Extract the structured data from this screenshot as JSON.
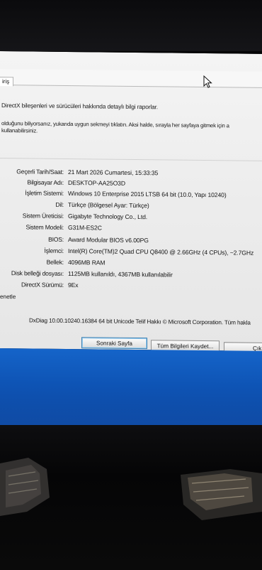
{
  "window": {
    "tab_label": "iriş",
    "intro_text": "DirectX bileşenleri ve sürücüleri hakkında detaylı bilgi raporlar.",
    "hint_line1": "olduğunu biliyorsanız, yukarıda uygun sekmeyi tıklatın. Aksi halde, sırayla her sayfaya gitmek için a",
    "hint_line2": "kullanabilirsiniz."
  },
  "system_info": [
    {
      "label": "Geçerli Tarih/Saat:",
      "value": "21 Mart 2026 Cumartesi, 15:33:35"
    },
    {
      "label": "Bilgisayar Adı:",
      "value": "DESKTOP-AA25O3D"
    },
    {
      "label": "İşletim Sistemi:",
      "value": "Windows 10 Enterprise 2015 LTSB 64 bit (10.0, Yapı 10240)"
    },
    {
      "label": "Dil:",
      "value": "Türkçe (Bölgesel Ayar: Türkçe)"
    },
    {
      "label": "Sistem Üreticisi:",
      "value": "Gigabyte Technology Co., Ltd."
    },
    {
      "label": "Sistem Modeli:",
      "value": "G31M-ES2C"
    },
    {
      "label": "BIOS:",
      "value": "Award Modular BIOS v6.00PG"
    },
    {
      "label": "İşlemci:",
      "value": "Intel(R) Core(TM)2 Quad CPU    Q8400  @ 2.66GHz (4 CPUs), ~2.7GHz"
    },
    {
      "label": "Bellek:",
      "value": "4096MB RAM"
    },
    {
      "label": "Disk belleği dosyası:",
      "value": "1125MB kullanıldı, 4367MB kullanılabilir"
    },
    {
      "label": "DirectX Sürümü:",
      "value": "9Ex"
    }
  ],
  "footer": {
    "rehber_label": "enetle",
    "version_text": "DxDiag 10.00.10240.16384 64 bit Unicode  Telif Hakkı © Microsoft Corporation. Tüm hakla",
    "next_page_button": "Sonraki Sayfa",
    "save_all_button": "Tüm Bilgileri Kaydet...",
    "exit_button": "Çık"
  },
  "icons": {
    "cursor": "mouse-pointer-icon"
  },
  "colors": {
    "window_bg": "#ededed",
    "desktop_blue": "#0e54b5",
    "focused_button_border": "#3c7fb1"
  }
}
